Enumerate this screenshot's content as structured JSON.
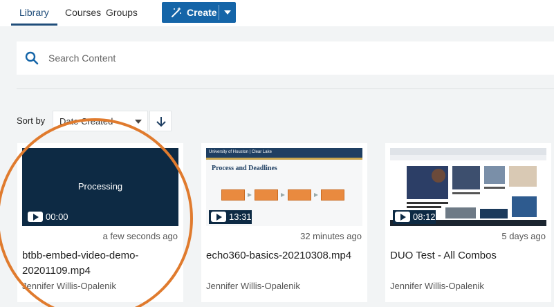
{
  "nav": {
    "tabs": [
      {
        "label": "Library",
        "active": true
      },
      {
        "label": "Courses",
        "active": false
      },
      {
        "label": "Groups",
        "active": false
      }
    ],
    "create_label": "Create"
  },
  "search": {
    "placeholder": "Search Content"
  },
  "sort": {
    "label": "Sort by",
    "selected": "Date Created",
    "direction": "descending"
  },
  "cards": [
    {
      "thumbnail_text": "Processing",
      "duration": "00:00",
      "when": "a few seconds ago",
      "title": "btbb-embed-video-demo-20201109.mp4",
      "owner": "Jennifer Willis-Opalenik"
    },
    {
      "thumbnail_text": "",
      "duration": "13:31",
      "when": "32 minutes ago",
      "title": "echo360-basics-20210308.mp4",
      "owner": "Jennifer Willis-Opalenik"
    },
    {
      "thumbnail_text": "",
      "duration": "08:12",
      "when": "5 days ago",
      "title": "DUO Test - All Combos",
      "owner": "Jennifer Willis-Opalenik"
    }
  ],
  "thumbnails": {
    "slide_header": "University of Houston | Clear Lake",
    "slide_title": "Process and Deadlines"
  },
  "colors": {
    "accent": "#1565a8",
    "annotation_circle": "#e07b2e",
    "thumb_bg": "#0d2a44"
  }
}
